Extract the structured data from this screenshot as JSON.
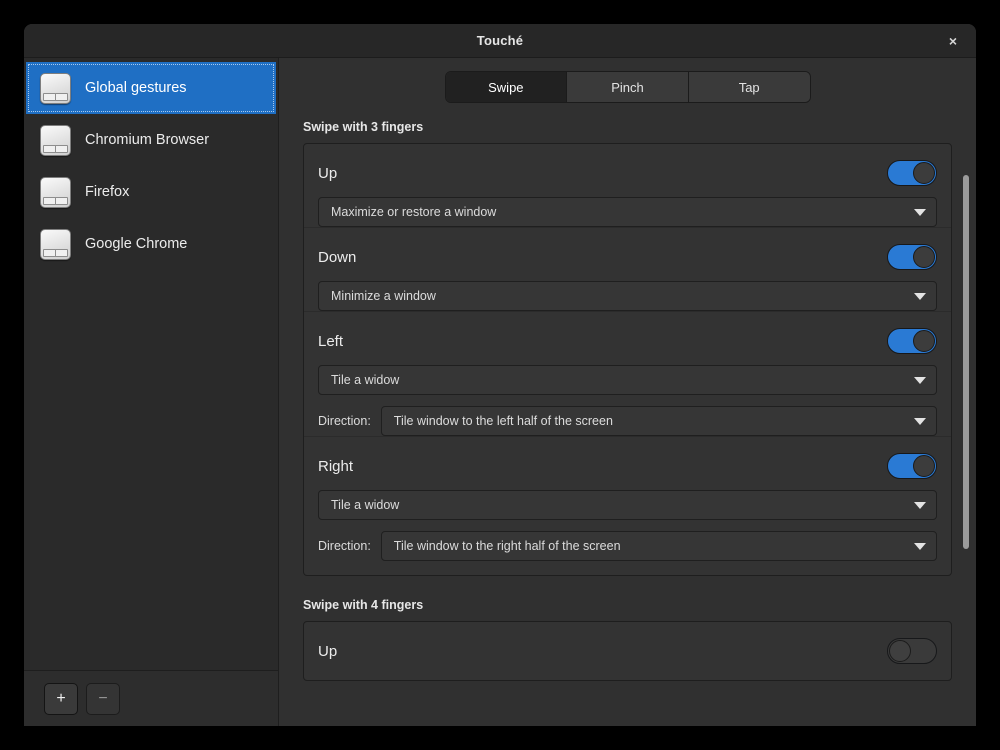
{
  "window": {
    "title": "Touché",
    "close_label": "×"
  },
  "sidebar": {
    "items": [
      {
        "label": "Global gestures",
        "icon": "touchpad-icon",
        "selected": true
      },
      {
        "label": "Chromium Browser",
        "icon": "touchpad-icon",
        "selected": false
      },
      {
        "label": "Firefox",
        "icon": "touchpad-icon",
        "selected": false
      },
      {
        "label": "Google Chrome",
        "icon": "touchpad-icon",
        "selected": false
      }
    ],
    "toolbar": {
      "add_label": "+",
      "remove_label": "−"
    }
  },
  "tabs": [
    {
      "label": "Swipe",
      "active": true
    },
    {
      "label": "Pinch",
      "active": false
    },
    {
      "label": "Tap",
      "active": false
    }
  ],
  "sections": [
    {
      "title": "Swipe with 3 fingers",
      "gestures": [
        {
          "name": "Up",
          "enabled": true,
          "action": "Maximize or restore a window",
          "direction_label": null,
          "direction_value": null
        },
        {
          "name": "Down",
          "enabled": true,
          "action": "Minimize a window",
          "direction_label": null,
          "direction_value": null
        },
        {
          "name": "Left",
          "enabled": true,
          "action": "Tile a widow",
          "direction_label": "Direction:",
          "direction_value": "Tile window to the left half of the screen"
        },
        {
          "name": "Right",
          "enabled": true,
          "action": "Tile a widow",
          "direction_label": "Direction:",
          "direction_value": "Tile window to the right half of the screen"
        }
      ]
    },
    {
      "title": "Swipe with 4 fingers",
      "gestures": [
        {
          "name": "Up",
          "enabled": false,
          "action": null,
          "direction_label": null,
          "direction_value": null
        }
      ]
    }
  ],
  "colors": {
    "accent": "#2a7ad4",
    "selection": "#1f6fc4",
    "window_bg": "#303030",
    "sidebar_bg": "#2a2a2a",
    "card_bg": "#333333",
    "scrollbar": "#9b9b9b"
  }
}
